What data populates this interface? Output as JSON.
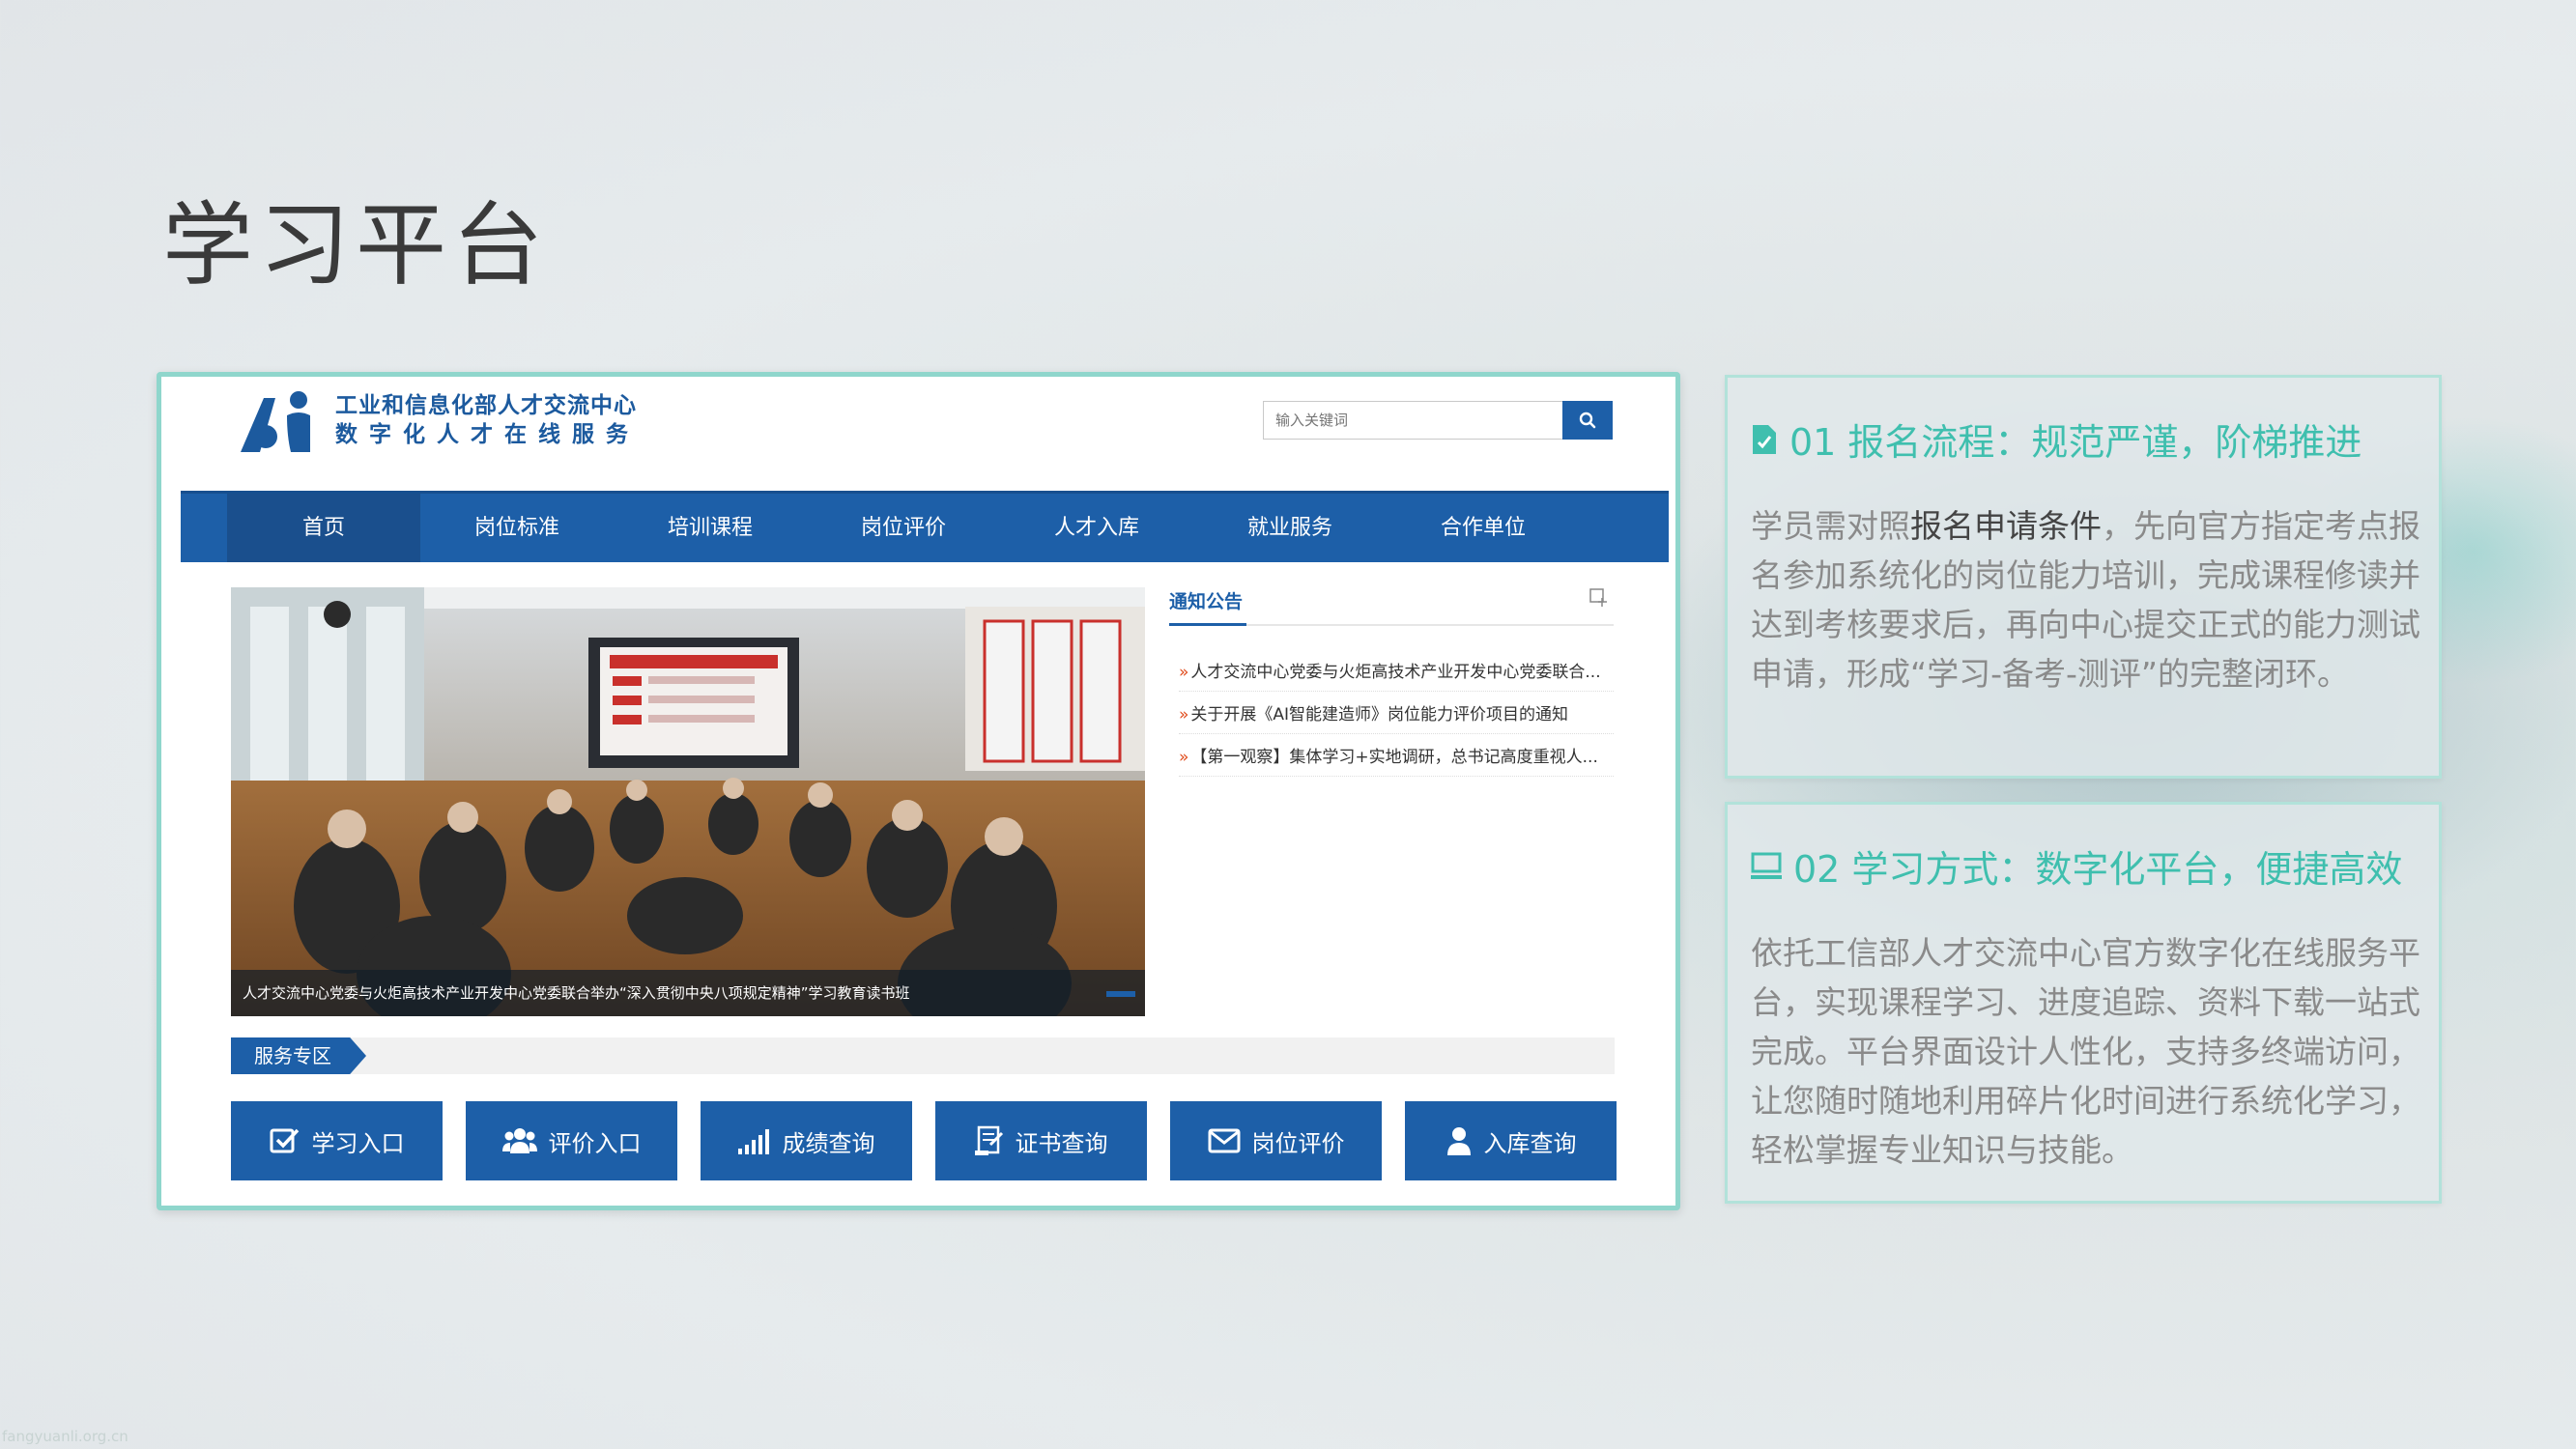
{
  "slide": {
    "title": "学习平台",
    "watermark": "fangyuanli.org.cn"
  },
  "website": {
    "logo_line1": "工业和信息化部人才交流中心",
    "logo_line2": "数字化人才在线服务",
    "search": {
      "placeholder": "输入关键词"
    },
    "nav": [
      "首页",
      "岗位标准",
      "培训课程",
      "岗位评价",
      "人才入库",
      "就业服务",
      "合作单位"
    ],
    "nav_active": "首页",
    "slider_caption": "人才交流中心党委与火炬高技术产业开发中心党委联合举办“深入贯彻中央八项规定精神”学习教育读书班",
    "notice": {
      "title": "通知公告",
      "items": [
        "人才交流中心党委与火炬高技术产业开发中心党委联合...",
        "关于开展《AI智能建造师》岗位能力评价项目的通知",
        "【第一观察】集体学习+实地调研，总书记高度重视人..."
      ]
    },
    "service": {
      "title": "服务专区",
      "buttons": [
        {
          "label": "学习入口",
          "icon": "checkbox-icon"
        },
        {
          "label": "评价入口",
          "icon": "users-icon"
        },
        {
          "label": "成绩查询",
          "icon": "bar-signal-icon"
        },
        {
          "label": "证书查询",
          "icon": "certificate-icon"
        },
        {
          "label": "岗位评价",
          "icon": "envelope-icon"
        },
        {
          "label": "入库查询",
          "icon": "person-icon"
        }
      ]
    },
    "brand_color": "#1d5fa8"
  },
  "cards": [
    {
      "heading": "01 报名流程：规范严谨，阶梯推进",
      "icon": "document-icon",
      "body_pre": "学员需对照",
      "body_hl": "报名申请条件",
      "body_post": "，先向官方指定考点报名参加系统化的岗位能力培训，完成课程修读并达到考核要求后，再向中心提交正式的能力测试申请，形成“学习-备考-测评”的完整闭环。"
    },
    {
      "heading": "02 学习方式：数字化平台，便捷高效",
      "icon": "monitor-icon",
      "body": "依托工信部人才交流中心官方数字化在线服务平台，实现课程学习、进度追踪、资料下载一站式完成。平台界面设计人性化，支持多终端访问，让您随时随地利用碎片化时间进行系统化学习，轻松掌握专业知识与技能。"
    }
  ],
  "colors": {
    "accent": "#3fbfae",
    "frame_border": "#8fd6cc"
  }
}
